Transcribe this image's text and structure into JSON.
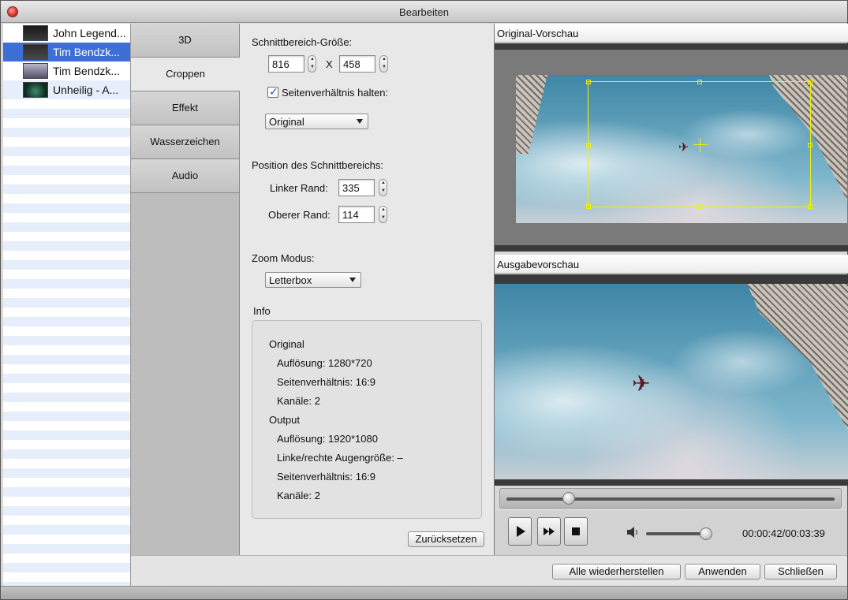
{
  "window": {
    "title": "Bearbeiten"
  },
  "file_list": [
    {
      "label": "John Legend...",
      "selected": false
    },
    {
      "label": "Tim Bendzk...",
      "selected": true
    },
    {
      "label": "Tim Bendzk...",
      "selected": false
    },
    {
      "label": "Unheilig - A...",
      "selected": false
    }
  ],
  "tabs": [
    {
      "label": "3D",
      "active": false
    },
    {
      "label": "Croppen",
      "active": true
    },
    {
      "label": "Effekt",
      "active": false
    },
    {
      "label": "Wasserzeichen",
      "active": false
    },
    {
      "label": "Audio",
      "active": false
    }
  ],
  "crop": {
    "size_label": "Schnittbereich-Größe:",
    "width": "816",
    "x_separator": "X",
    "height": "458",
    "keep_ratio_label": "Seitenverhältnis halten:",
    "keep_ratio_checked": true,
    "ratio_select": "Original",
    "position_label": "Position des Schnittbereichs:",
    "left_label": "Linker Rand:",
    "left_value": "335",
    "top_label": "Oberer Rand:",
    "top_value": "114",
    "zoom_label": "Zoom Modus:",
    "zoom_select": "Letterbox"
  },
  "info": {
    "title": "Info",
    "original_heading": "Original",
    "original_resolution": "Auflösung: 1280*720",
    "original_aspect": "Seitenverhältnis: 16:9",
    "original_channels": "Kanäle: 2",
    "output_heading": "Output",
    "output_resolution": "Auflösung: 1920*1080",
    "output_eye_size": "Linke/rechte Augengröße: –",
    "output_aspect": "Seitenverhältnis: 16:9",
    "output_channels": "Kanäle: 2"
  },
  "buttons": {
    "reset": "Zurücksetzen",
    "restore_all": "Alle wiederherstellen",
    "apply": "Anwenden",
    "close": "Schließen"
  },
  "preview": {
    "original_title": "Original-Vorschau",
    "output_title": "Ausgabevorschau"
  },
  "player": {
    "time": "00:00:42/00:03:39",
    "seek_fraction": 0.19,
    "volume_fraction": 0.9,
    "icons": [
      "play-icon",
      "fast-forward-icon",
      "stop-icon",
      "volume-icon"
    ]
  },
  "colors": {
    "selection": "#3d6fd6",
    "crop_frame": "#f2f000",
    "close_button": "#d6302a"
  }
}
